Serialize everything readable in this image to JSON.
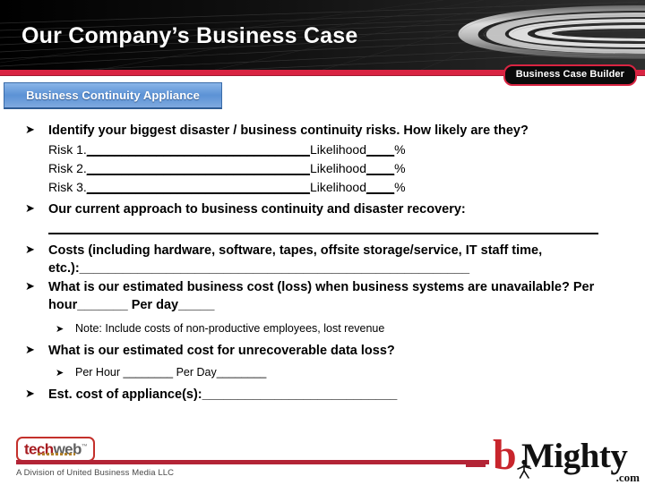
{
  "header": {
    "title": "Our Company’s Business Case",
    "badge_label": "Business Case Builder",
    "accent_red": "#d92442",
    "background": "#000000"
  },
  "section_tab": {
    "label": "Business Continuity Appliance",
    "fill": "#5d93d6"
  },
  "content": {
    "bullet_marker": "➤",
    "sub_bullet_marker": "➤",
    "items": [
      {
        "level": 1,
        "text": "Identify your biggest disaster / business continuity risks. How likely are they?"
      },
      {
        "level": "plain",
        "label": "Risk 1.",
        "fill1": "________________________________",
        "mid": "Likelihood",
        "fill2": "____",
        "suffix": "%"
      },
      {
        "level": "plain",
        "label": "Risk 2.",
        "fill1": "________________________________",
        "mid": "Likelihood",
        "fill2": "____",
        "suffix": "%"
      },
      {
        "level": "plain",
        "label": "Risk 3.",
        "fill1": "________________________________",
        "mid": "Likelihood",
        "fill2": "____",
        "suffix": "%"
      },
      {
        "level": 1,
        "text": "Our current approach to business continuity and disaster recovery:"
      },
      {
        "level": "rule"
      },
      {
        "level": 1,
        "text": "Costs  (including hardware, software, tapes, offsite storage/service, IT staff time, etc.):______________________________________________________"
      },
      {
        "level": 1,
        "text": "What is our estimated business cost  (loss) when business systems are unavailable?   Per hour_______ Per day_____"
      },
      {
        "level": 2,
        "text": "Note: Include costs of non-productive employees, lost revenue"
      },
      {
        "level": 1,
        "text": "What is our estimated cost for unrecoverable data loss?"
      },
      {
        "level": 2,
        "text": "Per Hour ________    Per Day________"
      },
      {
        "level": 1,
        "text": "Est. cost of appliance(s):___________________________"
      }
    ]
  },
  "footer": {
    "techweb_tech": "tech",
    "techweb_web": "web",
    "techweb_tm": "™",
    "division_text": "A Division of United Business Media LLC",
    "bmighty_b": "b",
    "bmighty_rest": "Mighty",
    "bmighty_com": ".com",
    "rule_color": "#b32436"
  }
}
